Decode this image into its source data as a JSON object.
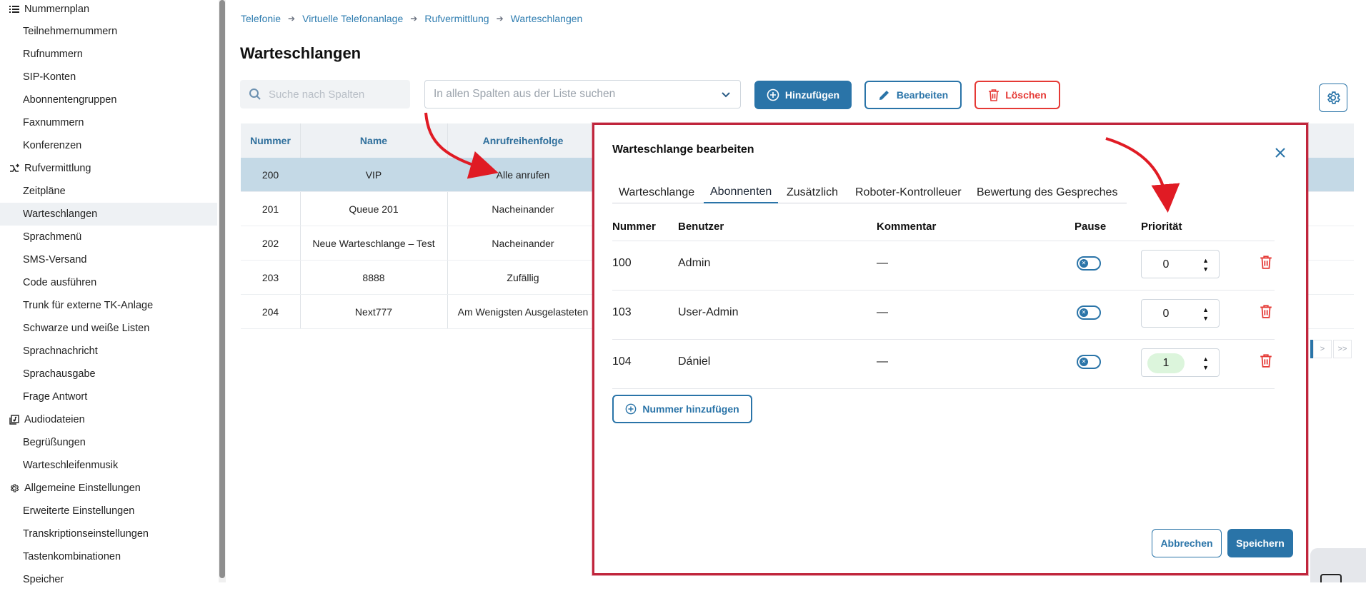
{
  "sidebar": {
    "items": [
      {
        "label": "Nummernplan",
        "group": true,
        "icon": "list-icon"
      },
      {
        "label": "Teilnehmernummern"
      },
      {
        "label": "Rufnummern"
      },
      {
        "label": "SIP-Konten"
      },
      {
        "label": "Abonnentengruppen"
      },
      {
        "label": "Faxnummern"
      },
      {
        "label": "Konferenzen"
      },
      {
        "label": "Rufvermittlung",
        "group": true,
        "icon": "route-icon"
      },
      {
        "label": "Zeitpläne"
      },
      {
        "label": "Warteschlangen",
        "active": true
      },
      {
        "label": "Sprachmenü"
      },
      {
        "label": "SMS-Versand"
      },
      {
        "label": "Code ausführen"
      },
      {
        "label": "Trunk für externe TK-Anlage"
      },
      {
        "label": "Schwarze und weiße Listen"
      },
      {
        "label": "Sprachnachricht"
      },
      {
        "label": "Sprachausgabe"
      },
      {
        "label": "Frage Antwort"
      },
      {
        "label": "Audiodateien",
        "group": true,
        "icon": "audio-files-icon"
      },
      {
        "label": "Begrüßungen"
      },
      {
        "label": "Warteschleifenmusik"
      },
      {
        "label": "Allgemeine Einstellungen",
        "group": true,
        "icon": "gear-icon"
      },
      {
        "label": "Erweiterte Einstellungen"
      },
      {
        "label": "Transkriptionseinstellungen"
      },
      {
        "label": "Tastenkombinationen"
      },
      {
        "label": "Speicher"
      }
    ]
  },
  "breadcrumb": [
    "Telefonie",
    "Virtuelle Telefonanlage",
    "Rufvermittlung",
    "Warteschlangen"
  ],
  "page_title": "Warteschlangen",
  "search": {
    "placeholder": "Suche nach Spalten"
  },
  "filter": {
    "placeholder": "In allen Spalten aus der Liste suchen"
  },
  "toolbar": {
    "add_label": "Hinzufügen",
    "edit_label": "Bearbeiten",
    "delete_label": "Löschen"
  },
  "table": {
    "headers": [
      "Nummer",
      "Name",
      "Anrufreihenfolge"
    ],
    "rows": [
      [
        "200",
        "VIP",
        "Alle anrufen"
      ],
      [
        "201",
        "Queue 201",
        "Nacheinander"
      ],
      [
        "202",
        "Neue Warteschlange – Test",
        "Nacheinander"
      ],
      [
        "203",
        "8888",
        "Zufällig"
      ],
      [
        "204",
        "Next777",
        "Am Wenigsten Ausgelasteten"
      ]
    ]
  },
  "pager": {
    "next": ">",
    "last": ">>"
  },
  "modal": {
    "title": "Warteschlange bearbeiten",
    "tabs": [
      "Warteschlange",
      "Abonnenten",
      "Zusätzlich",
      "Roboter-Kontrolleuer",
      "Bewertung des Gespreches"
    ],
    "active_tab": "Abonnenten",
    "columns": [
      "Nummer",
      "Benutzer",
      "Kommentar",
      "Pause",
      "Priorität"
    ],
    "rows": [
      {
        "nummer": "100",
        "benutzer": "Admin",
        "kommentar": "—",
        "prioritaet": "0"
      },
      {
        "nummer": "103",
        "benutzer": "User-Admin",
        "kommentar": "—",
        "prioritaet": "0"
      },
      {
        "nummer": "104",
        "benutzer": "Dániel",
        "kommentar": "—",
        "prioritaet": "1"
      }
    ],
    "add_number_label": "Nummer hinzufügen",
    "cancel_label": "Abbrechen",
    "save_label": "Speichern"
  },
  "colors": {
    "accent": "#2a74a8",
    "danger": "#e53935",
    "highlight_border": "#c0253c",
    "selected_row": "#c4d9e6"
  }
}
